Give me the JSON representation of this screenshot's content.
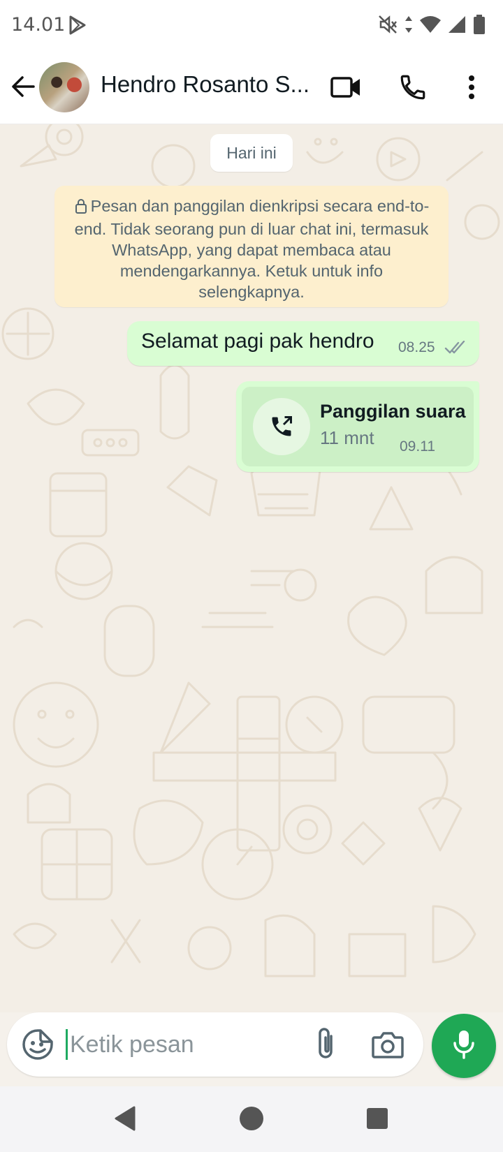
{
  "status_bar": {
    "time": "14.01",
    "icons": [
      "play-store-icon",
      "mute-icon",
      "data-arrows-icon",
      "wifi-icon",
      "signal-icon",
      "battery-icon"
    ]
  },
  "header": {
    "contact_name": "Hendro Rosanto S...",
    "icons": [
      "back-arrow-icon",
      "avatar",
      "video-call-icon",
      "phone-icon",
      "more-vert-icon"
    ]
  },
  "chat": {
    "date_chip": "Hari ini",
    "encryption_notice": "Pesan dan panggilan dienkripsi secara end-to-end. Tidak seorang pun di luar chat ini, termasuk WhatsApp, yang dapat membaca atau mendengarkannya. Ketuk untuk info selengkapnya.",
    "messages": [
      {
        "type": "text",
        "text": "Selamat pagi pak hendro",
        "time": "08.25",
        "status": "read-ticks"
      },
      {
        "type": "call",
        "title": "Panggilan suara",
        "duration": "11 mnt",
        "time": "09.11",
        "icon": "outgoing-call-icon"
      }
    ]
  },
  "composer": {
    "placeholder": "Ketik pesan",
    "icons": [
      "sticker-icon",
      "attach-icon",
      "camera-icon",
      "mic-icon"
    ]
  },
  "nav": {
    "icons": [
      "back-triangle-icon",
      "home-circle-icon",
      "recents-square-icon"
    ]
  },
  "colors": {
    "outgoing_bubble": "#d9fdd3",
    "notice_bg": "#fdefce",
    "accent_green": "#1fa855",
    "chat_bg": "#f3eee6"
  }
}
